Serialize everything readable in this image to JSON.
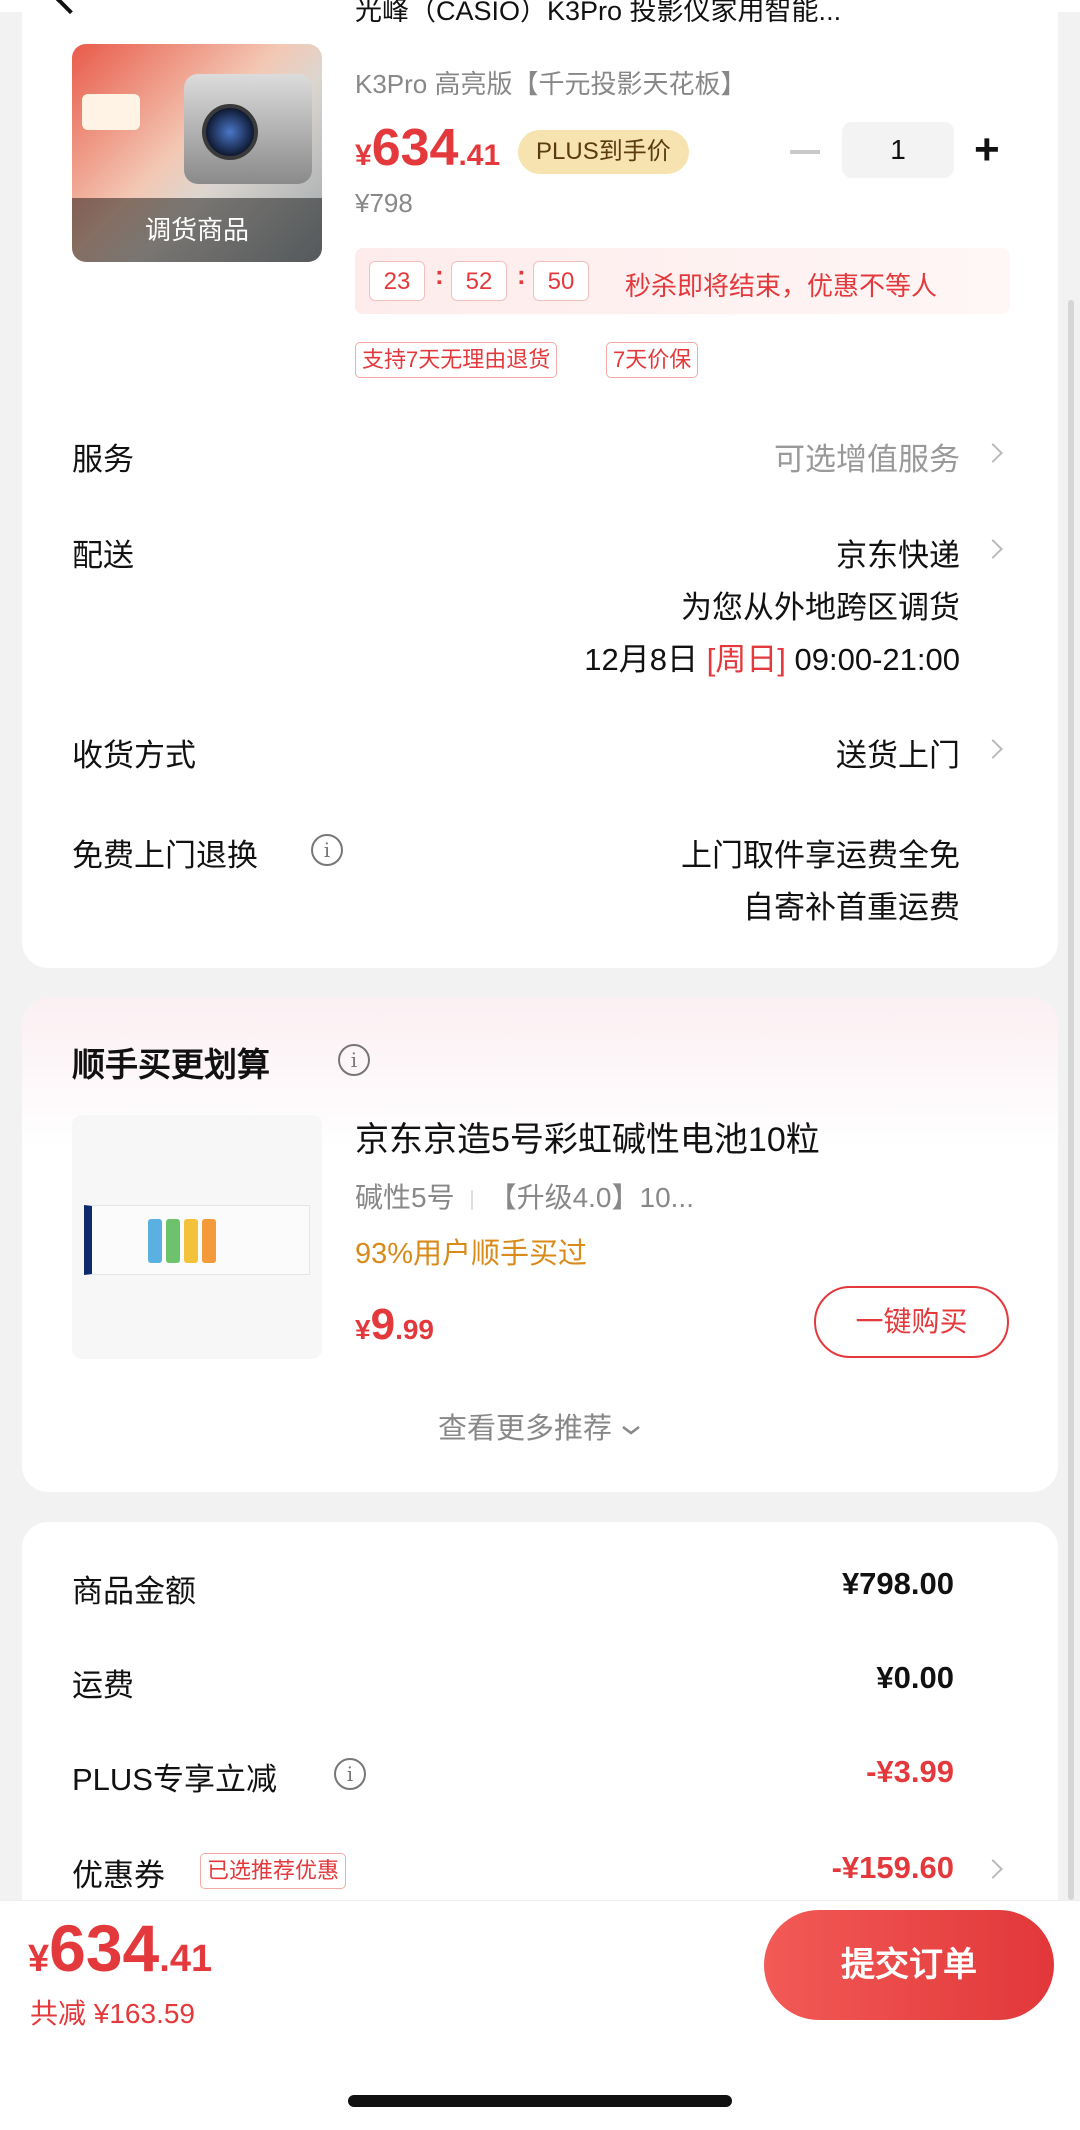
{
  "product": {
    "title": "光峰（CASIO）K3Pro 投影仪家用智能...",
    "spec": "K3Pro 高亮版【千元投影天花板】",
    "image_label": "调货商品",
    "price_currency": "¥",
    "price_int": "634",
    "price_dec": ".41",
    "plus_badge": "PLUS到手价",
    "original_price": "¥798",
    "quantity": "1",
    "minus_symbol": "−",
    "plus_symbol": "+"
  },
  "flash_sale": {
    "hours": "23",
    "minutes": "52",
    "seconds": "50",
    "sep": ":",
    "text": "秒杀即将结束，优惠不等人"
  },
  "tags": [
    "支持7天无理由退货",
    "7天价保"
  ],
  "rows": {
    "service_label": "服务",
    "service_value": "可选增值服务",
    "delivery_label": "配送",
    "delivery_carrier": "京东快递",
    "delivery_note": "为您从外地跨区调货",
    "delivery_date": "12月8日",
    "delivery_weekday": "[周日]",
    "delivery_time": "09:00-21:00",
    "receive_label": "收货方式",
    "receive_value": "送货上门",
    "return_label": "免费上门退换",
    "return_value_1": "上门取件享运费全免",
    "return_value_2": "自寄补首重运费",
    "info_symbol": "i"
  },
  "addon": {
    "title": "顺手买更划算",
    "name": "京东京造5号彩虹碱性电池10粒",
    "spec_1": "碱性5号",
    "spec_2": "【升级4.0】10...",
    "bought": "93%用户顺手买过",
    "price_currency": "¥",
    "price_int": "9",
    "price_dec": ".99",
    "buy_button": "一键购买",
    "more": "查看更多推荐"
  },
  "summary": {
    "goods_label": "商品金额",
    "goods_value": "¥798.00",
    "shipping_label": "运费",
    "shipping_value": "¥0.00",
    "plus_label": "PLUS专享立减",
    "plus_value": "-¥3.99",
    "coupon_label": "优惠券",
    "coupon_tag": "已选推荐优惠",
    "coupon_value": "-¥159.60"
  },
  "footer": {
    "total_currency": "¥",
    "total_int": "634",
    "total_dec": ".41",
    "saved": "共减 ¥163.59",
    "submit": "提交订单"
  },
  "colors": {
    "accent": "#e4393c",
    "plus_gold": "#f6e3b0",
    "bought_orange": "#d88a1a"
  }
}
